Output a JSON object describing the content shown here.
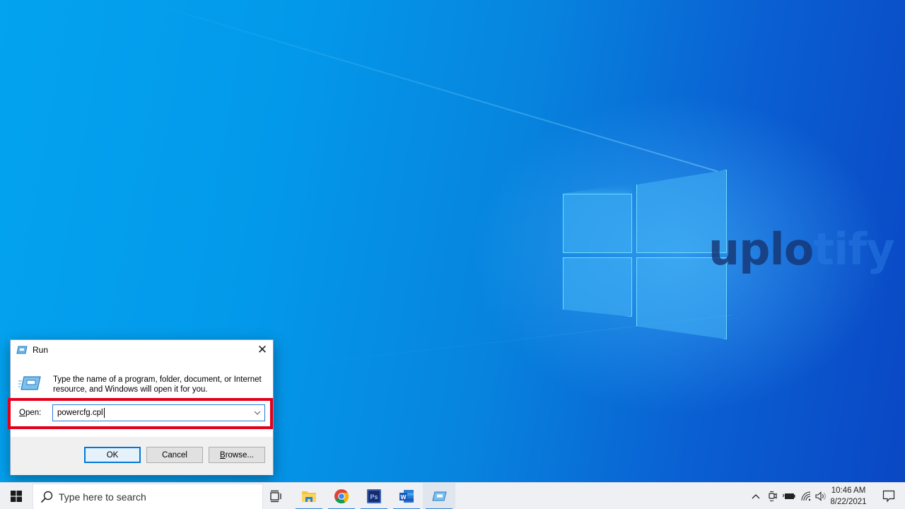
{
  "desktop": {
    "watermark": {
      "part1": "uplo",
      "part2": "tify"
    },
    "colors": {
      "wallpaper_light": "#03a3ef",
      "wallpaper_dark": "#0a47c4"
    }
  },
  "run_dialog": {
    "title": "Run",
    "title_icon": "run-icon",
    "close_icon": "close-icon",
    "description": "Type the name of a program, folder, document, or Internet resource, and Windows will open it for you.",
    "open_label_underlined": "O",
    "open_label_rest": "pen:",
    "open_value": "powercfg.cpl",
    "dropdown_icon": "chevron-down-icon",
    "highlight_color": "#e3001b",
    "buttons": {
      "ok": "OK",
      "cancel": "Cancel",
      "browse_underlined": "B",
      "browse_rest": "rowse..."
    }
  },
  "taskbar": {
    "start_icon": "windows-start-icon",
    "search_placeholder": "Type here to search",
    "pinned": [
      {
        "name": "task-view",
        "icon": "task-view-icon",
        "running": false
      },
      {
        "name": "file-explorer",
        "icon": "folder-icon",
        "running": true
      },
      {
        "name": "google-chrome",
        "icon": "chrome-icon",
        "running": true
      },
      {
        "name": "photoshop",
        "icon": "photoshop-icon",
        "label": "Ps",
        "running": true
      },
      {
        "name": "microsoft-word",
        "icon": "word-icon",
        "label": "W",
        "running": true
      },
      {
        "name": "run",
        "icon": "run-icon",
        "running": true,
        "active": true
      }
    ],
    "tray": {
      "chevron": "^",
      "icons": [
        "meet-now-icon",
        "battery-icon",
        "wifi-icon",
        "volume-icon"
      ],
      "time": "10:46 AM",
      "date": "8/22/2021",
      "notification_icon": "notification-icon"
    }
  }
}
